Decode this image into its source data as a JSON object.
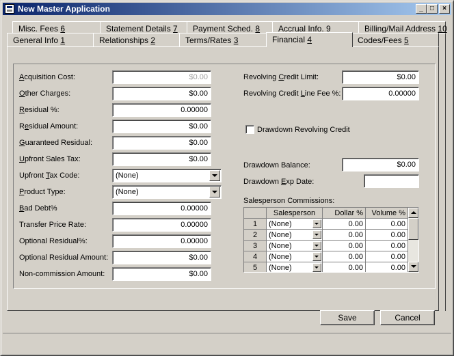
{
  "window": {
    "title": "New Master Application",
    "icon": "app-window-icon",
    "controls": [
      "minimize-icon",
      "maximize-icon",
      "close-icon"
    ]
  },
  "tabs_back": [
    {
      "label": "Misc. Fees ",
      "key": "6"
    },
    {
      "label": "Statement Details ",
      "key": "7"
    },
    {
      "label": "Payment Sched. ",
      "key": "8"
    },
    {
      "label": "Accrual Info. ",
      "key": "9"
    },
    {
      "label": "Billing/Mail Address ",
      "key": "10"
    }
  ],
  "tabs_front": [
    {
      "label": "General Info ",
      "key": "1"
    },
    {
      "label": "Relationships ",
      "key": "2"
    },
    {
      "label": "Terms/Rates ",
      "key": "3"
    },
    {
      "label": "Financial ",
      "key": "4",
      "active": true
    },
    {
      "label": "Codes/Fees ",
      "key": "5"
    }
  ],
  "left_fields": [
    {
      "label_pre": "",
      "label_key": "A",
      "label_post": "cquisition Cost:",
      "value": "$0.00",
      "disabled": true
    },
    {
      "label_pre": "",
      "label_key": "O",
      "label_post": "ther Charges:",
      "value": "$0.00"
    },
    {
      "label_pre": "",
      "label_key": "R",
      "label_post": "esidual %:",
      "value": "0.00000"
    },
    {
      "label_pre": "R",
      "label_key": "e",
      "label_post": "sidual Amount:",
      "value": "$0.00"
    },
    {
      "label_pre": "",
      "label_key": "G",
      "label_post": "uaranteed Residual:",
      "value": "$0.00"
    },
    {
      "label_pre": "",
      "label_key": "U",
      "label_post": "pfront Sales Tax:",
      "value": "$0.00"
    },
    {
      "label_pre": "Upfront ",
      "label_key": "T",
      "label_post": "ax Code:",
      "value": "(None)",
      "combo": true
    },
    {
      "label_pre": "",
      "label_key": "P",
      "label_post": "roduct Type:",
      "value": "(None)",
      "combo": true
    },
    {
      "label_pre": "",
      "label_key": "B",
      "label_post": "ad Debt%",
      "value": "0.00000"
    },
    {
      "label_pre": "Transfer Price Rate:",
      "label_key": "",
      "label_post": "",
      "value": "0.00000"
    },
    {
      "label_pre": "Optional Residual%:",
      "label_key": "",
      "label_post": "",
      "value": "0.00000"
    },
    {
      "label_pre": "Optional Residual Amount:",
      "label_key": "",
      "label_post": "",
      "value": "$0.00"
    },
    {
      "label_pre": "Non-commission Amount:",
      "label_key": "",
      "label_post": "",
      "value": "$0.00"
    }
  ],
  "right": {
    "revolving_limit": {
      "label_pre": "Revolving ",
      "label_key": "C",
      "label_post": "redit Limit:",
      "value": "$0.00"
    },
    "revolving_fee": {
      "label_pre": "Revolving Credit ",
      "label_key": "L",
      "label_post": "ine Fee %:",
      "value": "0.00000"
    },
    "drawdown_checkbox": {
      "label": "Drawdown Revolving Credit",
      "checked": false
    },
    "drawdown_balance": {
      "label": "Drawdown Balance:",
      "value": "$0.00"
    },
    "drawdown_exp": {
      "label_pre": "Drawdown ",
      "label_key": "E",
      "label_post": "xp Date:",
      "value": ""
    },
    "commissions_label": "Salesperson Commissions:"
  },
  "grid": {
    "headers": [
      "",
      "Salesperson",
      "Dollar %",
      "Volume %"
    ],
    "rows": [
      {
        "num": "1",
        "salesperson": "(None)",
        "dollar": "0.00",
        "volume": "0.00"
      },
      {
        "num": "2",
        "salesperson": "(None)",
        "dollar": "0.00",
        "volume": "0.00"
      },
      {
        "num": "3",
        "salesperson": "(None)",
        "dollar": "0.00",
        "volume": "0.00"
      },
      {
        "num": "4",
        "salesperson": "(None)",
        "dollar": "0.00",
        "volume": "0.00"
      },
      {
        "num": "5",
        "salesperson": "(None)",
        "dollar": "0.00",
        "volume": "0.00"
      }
    ]
  },
  "buttons": {
    "save": "Save",
    "cancel": "Cancel"
  }
}
